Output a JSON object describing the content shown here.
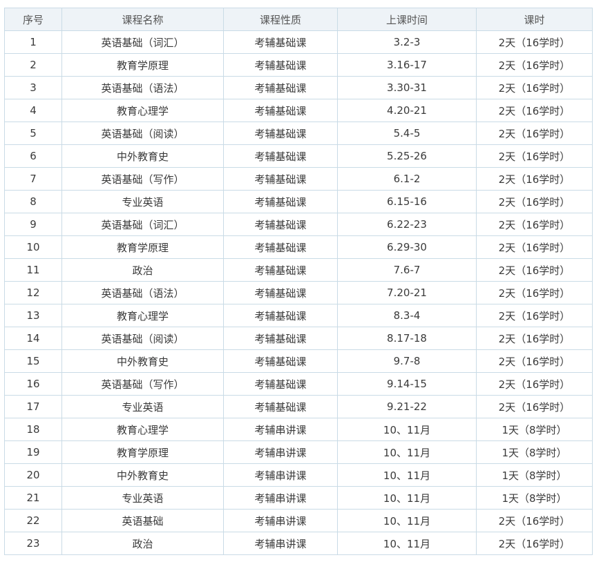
{
  "table": {
    "headers": [
      "序号",
      "课程名称",
      "课程性质",
      "上课时间",
      "课时"
    ],
    "rows": [
      [
        "1",
        "英语基础（词汇）",
        "考辅基础课",
        "3.2-3",
        "2天（16学时）"
      ],
      [
        "2",
        "教育学原理",
        "考辅基础课",
        "3.16-17",
        "2天（16学时）"
      ],
      [
        "3",
        "英语基础（语法）",
        "考辅基础课",
        "3.30-31",
        "2天（16学时）"
      ],
      [
        "4",
        "教育心理学",
        "考辅基础课",
        "4.20-21",
        "2天（16学时）"
      ],
      [
        "5",
        "英语基础（阅读）",
        "考辅基础课",
        "5.4-5",
        "2天（16学时）"
      ],
      [
        "6",
        "中外教育史",
        "考辅基础课",
        "5.25-26",
        "2天（16学时）"
      ],
      [
        "7",
        "英语基础（写作）",
        "考辅基础课",
        "6.1-2",
        "2天（16学时）"
      ],
      [
        "8",
        "专业英语",
        "考辅基础课",
        "6.15-16",
        "2天（16学时）"
      ],
      [
        "9",
        "英语基础（词汇）",
        "考辅基础课",
        "6.22-23",
        "2天（16学时）"
      ],
      [
        "10",
        "教育学原理",
        "考辅基础课",
        "6.29-30",
        "2天（16学时）"
      ],
      [
        "11",
        "政治",
        "考辅基础课",
        "7.6-7",
        "2天（16学时）"
      ],
      [
        "12",
        "英语基础（语法）",
        "考辅基础课",
        "7.20-21",
        "2天（16学时）"
      ],
      [
        "13",
        "教育心理学",
        "考辅基础课",
        "8.3-4",
        "2天（16学时）"
      ],
      [
        "14",
        "英语基础（阅读）",
        "考辅基础课",
        "8.17-18",
        "2天（16学时）"
      ],
      [
        "15",
        "中外教育史",
        "考辅基础课",
        "9.7-8",
        "2天（16学时）"
      ],
      [
        "16",
        "英语基础（写作）",
        "考辅基础课",
        "9.14-15",
        "2天（16学时）"
      ],
      [
        "17",
        "专业英语",
        "考辅基础课",
        "9.21-22",
        "2天（16学时）"
      ],
      [
        "18",
        "教育心理学",
        "考辅串讲课",
        "10、11月",
        "1天（8学时）"
      ],
      [
        "19",
        "教育学原理",
        "考辅串讲课",
        "10、11月",
        "1天（8学时）"
      ],
      [
        "20",
        "中外教育史",
        "考辅串讲课",
        "10、11月",
        "1天（8学时）"
      ],
      [
        "21",
        "专业英语",
        "考辅串讲课",
        "10、11月",
        "1天（8学时）"
      ],
      [
        "22",
        "英语基础",
        "考辅串讲课",
        "10、11月",
        "2天（16学时）"
      ],
      [
        "23",
        "政治",
        "考辅串讲课",
        "10、11月",
        "2天（16学时）"
      ]
    ]
  }
}
